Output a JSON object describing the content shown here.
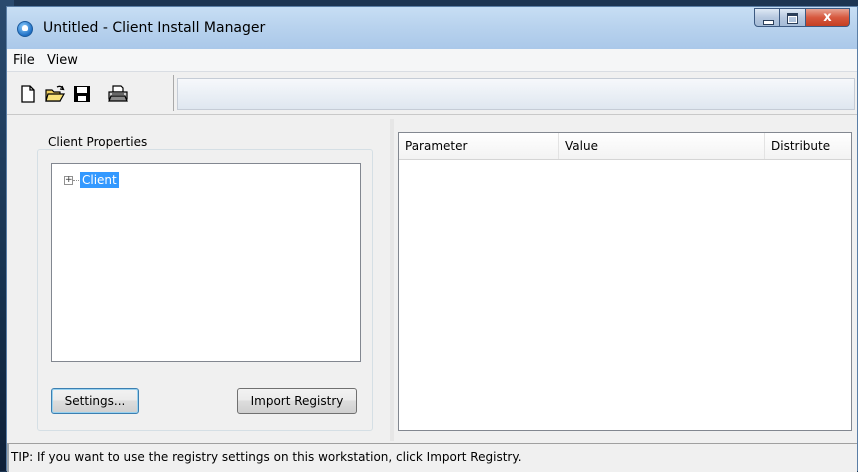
{
  "window": {
    "title": "Untitled - Client Install Manager",
    "close_glyph": "x"
  },
  "menu": {
    "items": [
      {
        "label": "File"
      },
      {
        "label": "View"
      }
    ]
  },
  "toolbar": {
    "buttons": [
      {
        "icon": "new-document-icon"
      },
      {
        "icon": "open-folder-icon"
      },
      {
        "icon": "save-disk-icon"
      },
      {
        "icon": "print-icon"
      }
    ]
  },
  "client_properties": {
    "group_label": "Client Properties",
    "tree": {
      "expander": "+",
      "root_node": "Client"
    },
    "settings_button": "Settings...",
    "import_button": "Import Registry"
  },
  "grid": {
    "columns": [
      "Parameter",
      "Value",
      "Distribute"
    ],
    "rows": []
  },
  "status": {
    "text": "TIP: If you want to use the registry settings on this workstation, click Import Registry."
  },
  "colors": {
    "selection": "#3399ff",
    "titlebar": "#b9d3ee",
    "close_button": "#d7583e"
  }
}
